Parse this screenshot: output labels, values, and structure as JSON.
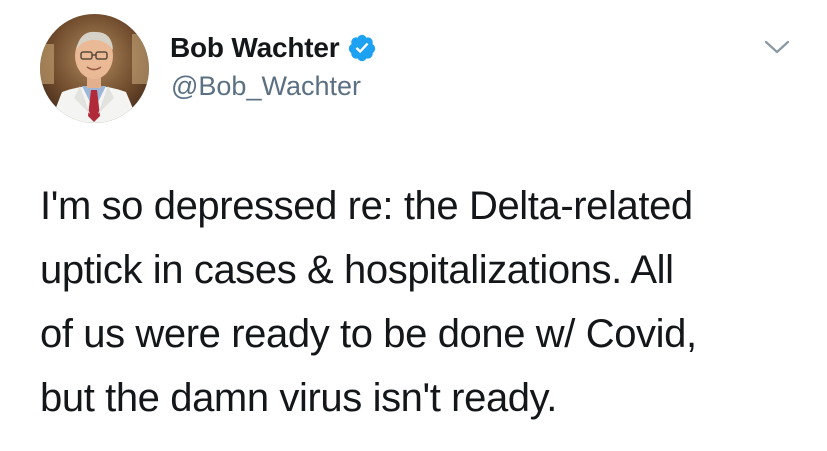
{
  "author": {
    "display_name": "Bob Wachter",
    "handle": "@Bob_Wachter",
    "verified": true,
    "verified_color": "#1da1f2"
  },
  "tweet": {
    "lines": [
      "I'm so depressed re: the Delta-related",
      "uptick in cases & hospitalizations. All",
      "of us were ready to be done w/ Covid,",
      "but the damn virus isn't ready."
    ]
  },
  "icons": {
    "verified": "verified-badge-icon",
    "more": "chevron-down-icon"
  },
  "colors": {
    "text": "#14171a",
    "secondary": "#5b7083",
    "chevron": "#8899a6"
  }
}
